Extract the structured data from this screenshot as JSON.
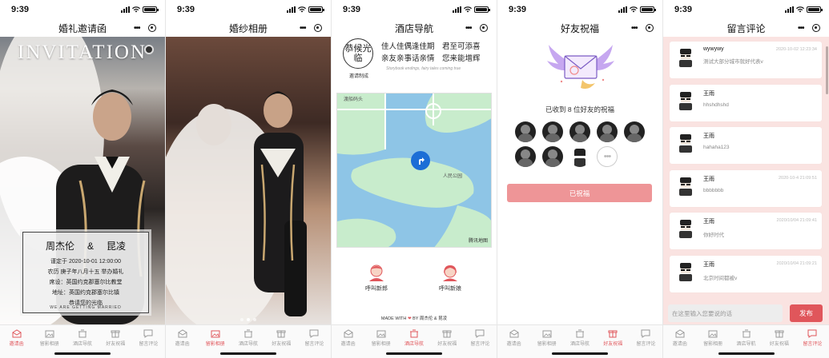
{
  "status_time": "9:39",
  "tab_labels": [
    "邀请函",
    "留影相册",
    "酒店导航",
    "好友祝福",
    "留言评论"
  ],
  "screens": {
    "invitation": {
      "nav_title": "婚礼邀请函",
      "banner": "INVITATION",
      "groom": "周杰伦",
      "amp": "&",
      "bride": "昆凌",
      "lines": [
        "谨定于 2020-10-01 12:00:00",
        "农历 庚子年八月十五 举办婚礼",
        "席设：英国约克郡塞尔比教堂",
        "地址：英国约克郡塞尔比镇",
        "恭请您的光临"
      ],
      "card_footer": "WE ARE GETTING MARRIED",
      "active_tab": 0
    },
    "album": {
      "nav_title": "婚纱相册",
      "active_tab": 1
    },
    "hotel": {
      "nav_title": "酒店导航",
      "seal_text": "恭候光临",
      "seal_sub": "邀请制成",
      "poem_line1": "佳人佳偶逢佳期　君至可添喜",
      "poem_line2": "亲友亲事话亲情　您来能增辉",
      "poem_en": "Storybook endings, fairy tales coming true",
      "map_label_top": "渡船码头",
      "map_label_park": "人民公园",
      "map_logo": "腾讯地图",
      "call_groom": "呼叫新郎",
      "call_bride": "呼叫新娘",
      "made_prefix": "MADE WITH",
      "made_suffix": "BY 周杰伦 & 昆凌",
      "active_tab": 2
    },
    "blessing": {
      "nav_title": "好友祝福",
      "count_text": "已收到 8 位好友的祝福",
      "button_label": "已祝福",
      "active_tab": 3
    },
    "comments": {
      "nav_title": "留言评论",
      "items": [
        {
          "name": "wywywy",
          "time": "2020-10-02 12:23:34",
          "text": "测试大部分城市就好代表v"
        },
        {
          "name": "王雨",
          "time": "",
          "text": "hhshdhshd"
        },
        {
          "name": "王雨",
          "time": "",
          "text": "hahaha123"
        },
        {
          "name": "王雨",
          "time": "2020-10-4 21:09:51",
          "text": "bbbbbbb"
        },
        {
          "name": "王雨",
          "time": "2020/10/04 21:09:41",
          "text": "你好时代"
        },
        {
          "name": "王雨",
          "time": "2020/10/04 21:09:21",
          "text": "北京时间都被v"
        }
      ],
      "input_placeholder": "在这里输入您要说的话",
      "send_label": "发布",
      "active_tab": 4
    }
  },
  "colors": {
    "accent": "#e0565b",
    "blessed_button": "#ee9597",
    "comments_bg": "#fae3e1"
  }
}
